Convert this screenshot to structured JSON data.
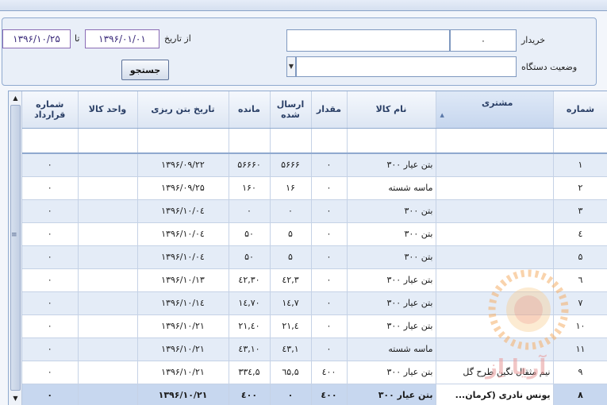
{
  "filters": {
    "date_from_label": "از تاریخ",
    "date_to_label": "تا",
    "date_from": "۱۳۹۶/۰۱/۰۱",
    "date_to": "۱۳۹۶/۱۰/۲۵",
    "buyer_label": "خریدار",
    "buyer_value": "۰",
    "device_status_label": "وضعیت دستگاه",
    "device_status_value": "",
    "search_label": "جستجو"
  },
  "grid": {
    "columns": {
      "contract_no": "شماره قرارداد",
      "unit": "واحد کالا",
      "concrete_date": "تاریخ بتن ریزی",
      "remaining": "مانده",
      "sent": "ارسال شده",
      "amount": "مقدار",
      "product": "نام کالا",
      "customer": "مشتری",
      "number": "شماره"
    },
    "rows": [
      {
        "contract": "۰",
        "unit": "",
        "date": "۱۳۹۶/۰۹/۲۲",
        "remaining": "۵۶۶۶۰",
        "sent": "۵۶۶۶",
        "amount": "۰",
        "product": "بتن عیار ۳۰۰",
        "customer": "",
        "number": "۱"
      },
      {
        "contract": "۰",
        "unit": "",
        "date": "۱۳۹۶/۰۹/۲۵",
        "remaining": "۱۶۰",
        "sent": "۱۶",
        "amount": "۰",
        "product": "ماسه شسته",
        "customer": "",
        "number": "۲"
      },
      {
        "contract": "۰",
        "unit": "",
        "date": "۱۳۹۶/۱۰/۰٤",
        "remaining": "۰",
        "sent": "۰",
        "amount": "۰",
        "product": "بتن ۳۰۰",
        "customer": "",
        "number": "۳"
      },
      {
        "contract": "۰",
        "unit": "",
        "date": "۱۳۹۶/۱۰/۰٤",
        "remaining": "۵۰",
        "sent": "۵",
        "amount": "۰",
        "product": "بتن ۳۰۰",
        "customer": "",
        "number": "٤"
      },
      {
        "contract": "۰",
        "unit": "",
        "date": "۱۳۹۶/۱۰/۰٤",
        "remaining": "۵۰",
        "sent": "۵",
        "amount": "۰",
        "product": "بتن ۳۰۰",
        "customer": "",
        "number": "۵"
      },
      {
        "contract": "۰",
        "unit": "",
        "date": "۱۳۹۶/۱۰/۱۳",
        "remaining": "٤۲,۳۰",
        "sent": "٤۲,۳",
        "amount": "۰",
        "product": "بتن عیار ۳۰۰",
        "customer": "",
        "number": "٦"
      },
      {
        "contract": "۰",
        "unit": "",
        "date": "۱۳۹۶/۱۰/۱٤",
        "remaining": "۱٤,۷۰",
        "sent": "۱٤,۷",
        "amount": "۰",
        "product": "بتن عیار ۳۰۰",
        "customer": "",
        "number": "۷"
      },
      {
        "contract": "۰",
        "unit": "",
        "date": "۱۳۹۶/۱۰/۲۱",
        "remaining": "۲۱,٤۰",
        "sent": "۲۱,٤",
        "amount": "۰",
        "product": "بتن عیار ۳۰۰",
        "customer": "",
        "number": "۱۰"
      },
      {
        "contract": "۰",
        "unit": "",
        "date": "۱۳۹۶/۱۰/۲۱",
        "remaining": "٤۳,۱۰",
        "sent": "٤۳,۱",
        "amount": "۰",
        "product": "ماسه شسته",
        "customer": "",
        "number": "۱۱"
      },
      {
        "contract": "۰",
        "unit": "",
        "date": "۱۳۹۶/۱۰/۲۱",
        "remaining": "۳۳٤,۵",
        "sent": "٦۵,۵",
        "amount": "٤۰۰",
        "product": "بتن عیار ۳۰۰",
        "customer": "نیم مثقال نگین طرح گل",
        "number": "۹"
      },
      {
        "contract": "۰",
        "unit": "",
        "date": "۱۳۹۶/۱۰/۲۱",
        "remaining": "٤۰۰",
        "sent": "۰",
        "amount": "٤۰۰",
        "product": "بتن عیار ۳۰۰",
        "customer": "یونس نادری (کرمان...",
        "number": "۸"
      }
    ]
  },
  "watermark": {
    "text": "آریا اِز"
  }
}
